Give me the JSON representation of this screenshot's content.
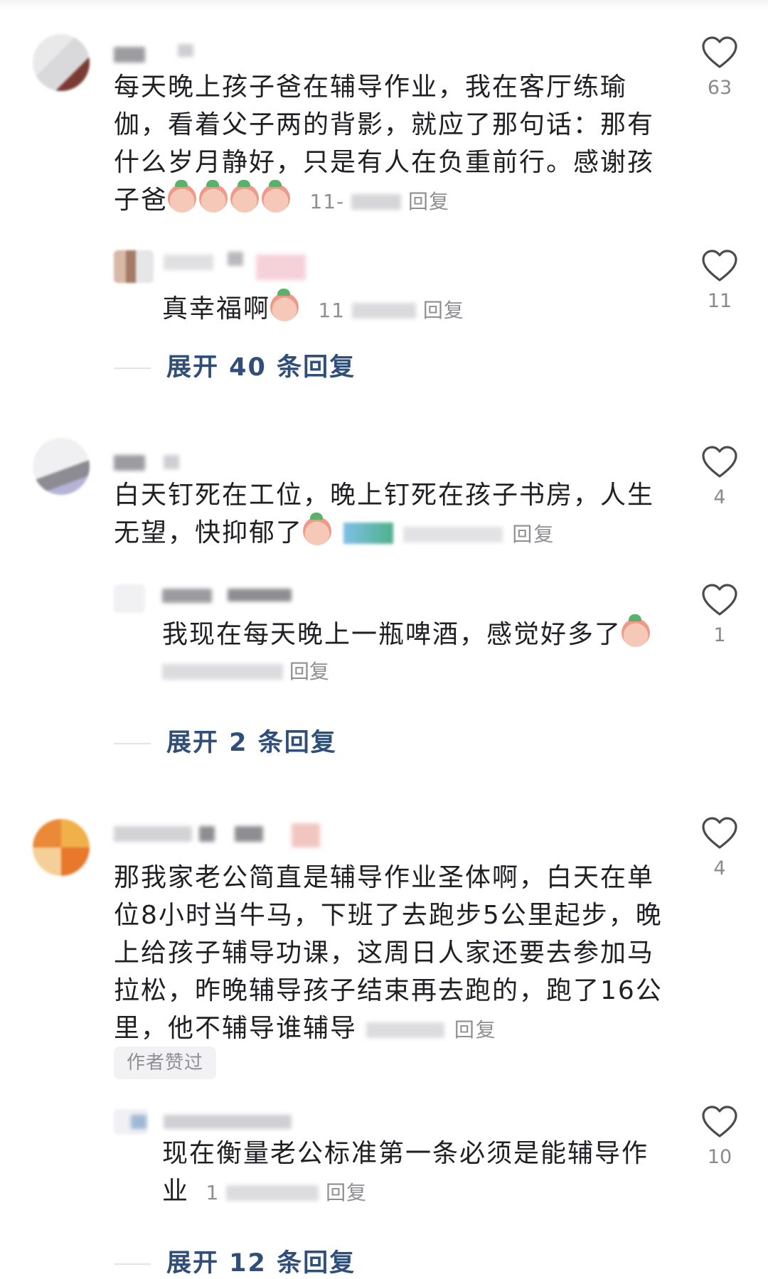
{
  "comments": [
    {
      "text": "每天晚上孩子爸在辅导作业，我在客厅练瑜伽，看着父子两的背影，就应了那句话：那有什么岁月静好，只是有人在负重前行。感谢孩子爸",
      "time": "11-",
      "reply_label": "回复",
      "likes": "63",
      "replies": [
        {
          "text": "真幸福啊",
          "time": "11",
          "reply_label": "回复",
          "likes": "11"
        }
      ],
      "expand_label": "展开 40 条回复"
    },
    {
      "text": "白天钉死在工位，晚上钉死在孩子书房，人生无望，快抑郁了",
      "reply_label": "回复",
      "likes": "4",
      "replies": [
        {
          "text": "我现在每天晚上一瓶啤酒，感觉好多了",
          "reply_label": "回复",
          "likes": "1"
        }
      ],
      "expand_label": "展开 2 条回复"
    },
    {
      "text": "那我家老公简直是辅导作业圣体啊，白天在单位8小时当牛马，下班了去跑步5公里起步，晚上给孩子辅导功课，这周日人家还要去参加马拉松，昨晚辅导孩子结束再去跑的，跑了16公里，他不辅导谁辅导",
      "reply_label": "回复",
      "likes": "4",
      "badge": "作者赞过",
      "replies": [
        {
          "text": "现在衡量老公标准第一条必须是能辅导作业",
          "time": "1",
          "reply_label": "回复",
          "likes": "10"
        }
      ],
      "expand_label": "展开 12 条回复"
    }
  ],
  "icons": {
    "like": "heart-outline-icon",
    "emoji": "crying-face-emoji-icon"
  },
  "colors": {
    "text": "#1f1f24",
    "meta": "#8e8e93",
    "expand": "#2f4f7a",
    "heart": "#4a4a50"
  }
}
